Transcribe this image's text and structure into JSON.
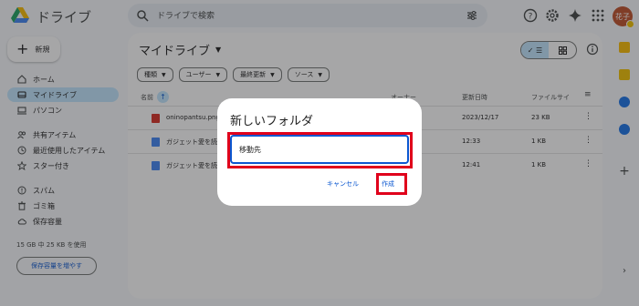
{
  "header": {
    "app_title": "ドライブ",
    "search_placeholder": "ドライブで検索",
    "avatar_text": "花子"
  },
  "sidebar": {
    "new_label": "新規",
    "items": [
      {
        "label": "ホーム",
        "icon": "home-icon"
      },
      {
        "label": "マイドライブ",
        "icon": "my-drive-icon"
      },
      {
        "label": "パソコン",
        "icon": "computer-icon"
      },
      {
        "label": "共有アイテム",
        "icon": "shared-icon"
      },
      {
        "label": "最近使用したアイテム",
        "icon": "clock-icon"
      },
      {
        "label": "スター付き",
        "icon": "star-icon"
      },
      {
        "label": "スパム",
        "icon": "spam-icon"
      },
      {
        "label": "ゴミ箱",
        "icon": "trash-icon"
      },
      {
        "label": "保存容量",
        "icon": "cloud-icon"
      }
    ],
    "storage_text": "15 GB 中 25 KB を使用",
    "storage_button": "保存容量を増やす"
  },
  "main": {
    "title": "マイドライブ",
    "filters": [
      "種類",
      "ユーザー",
      "最終更新",
      "ソース"
    ],
    "columns": {
      "name": "名前",
      "owner": "オーナー",
      "modified": "更新日時",
      "size": "ファイルサイ"
    },
    "files": [
      {
        "name": "oninopantsu.png",
        "date": "2023/12/17",
        "size": "23 KB",
        "type": "image"
      },
      {
        "name": "ガジェット愛を読",
        "date": "12:33",
        "size": "1 KB",
        "type": "doc"
      },
      {
        "name": "ガジェット愛を読",
        "date": "12:41",
        "size": "1 KB",
        "type": "doc"
      }
    ]
  },
  "dialog": {
    "title": "新しいフォルダ",
    "input_value": "移動先",
    "cancel_label": "キャンセル",
    "create_label": "作成"
  },
  "colors": {
    "accent": "#0b57d0",
    "highlight": "#e0001b",
    "active_nav": "#c2e7ff"
  }
}
